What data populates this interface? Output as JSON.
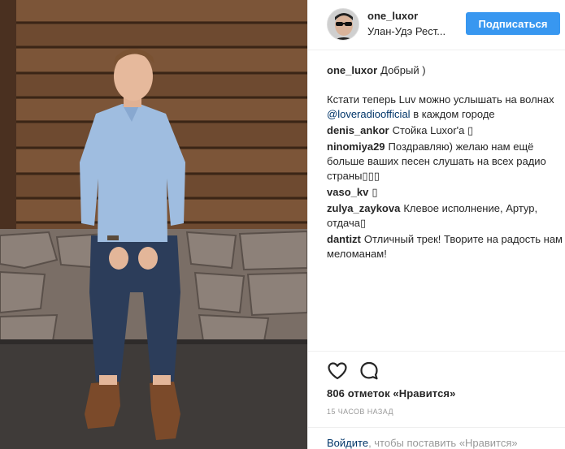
{
  "post": {
    "username": "one_luxor",
    "location": "Улан-Удэ Рест...",
    "follow_label": "Подписаться"
  },
  "caption": {
    "username": "one_luxor",
    "text1": "Добрый )",
    "text2_before": "Кстати теперь Luv можно услышать на волнах ",
    "mention": "@loveradioofficial",
    "text2_after": " в каждом городе"
  },
  "comments": [
    {
      "user": "denis_ankor",
      "text": "Стойка Luxor'a ▯"
    },
    {
      "user": "ninomiya29",
      "text": "Поздравляю) желаю нам ещё больше ваших песен слушать на всех радио страны▯▯▯"
    },
    {
      "user": "vaso_kv",
      "text": "▯"
    },
    {
      "user": "zulya_zaykova",
      "text": "Клевое исполнение, Артур, отдача▯"
    },
    {
      "user": "dantizt",
      "text": "Отличный трек! Творите на радость нам меломанам!"
    }
  ],
  "actions": {
    "like_icon": "heart-icon",
    "comment_icon": "comment-icon",
    "likes_text": "806 отметок «Нравится»",
    "time_text": "15 часов назад"
  },
  "login": {
    "link": "Войдите",
    "rest": ", чтобы поставить «Нравится»"
  },
  "colors": {
    "accent": "#3897f0",
    "link": "#003569",
    "muted": "#999999",
    "divider": "#efefef"
  }
}
